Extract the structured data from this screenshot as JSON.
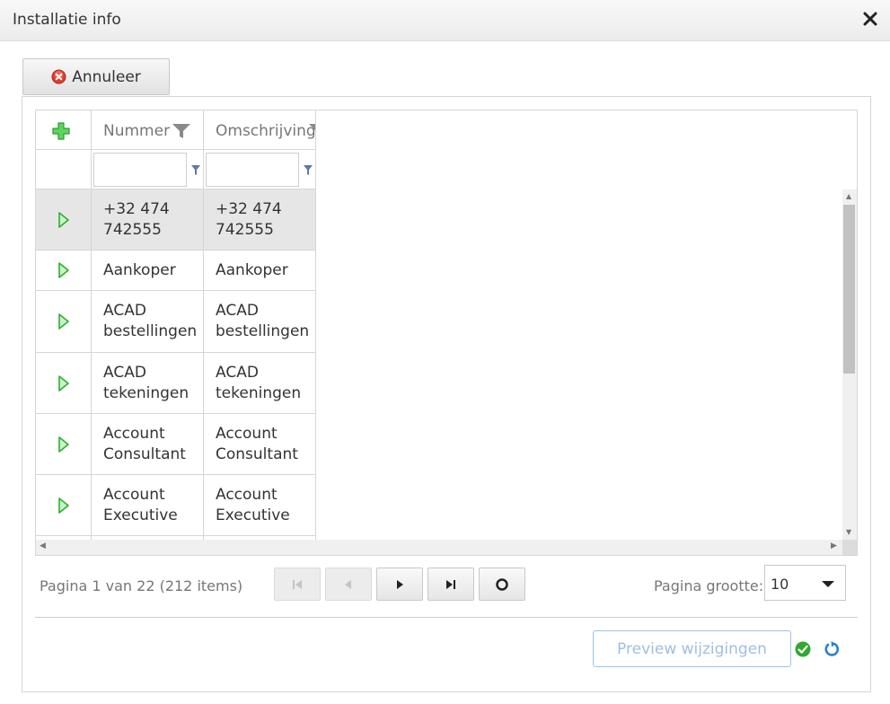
{
  "window": {
    "title": "Installatie info"
  },
  "toolbar": {
    "cancel_label": "Annuleer"
  },
  "grid": {
    "columns": [
      "Nummer",
      "Omschrijving"
    ],
    "rows": [
      {
        "nummer": [
          "+32 474",
          "742555"
        ],
        "omschrijving": [
          "+32 474",
          "742555"
        ],
        "selected": true
      },
      {
        "nummer": [
          "Aankoper"
        ],
        "omschrijving": [
          "Aankoper"
        ]
      },
      {
        "nummer": [
          "ACAD",
          "bestellingen"
        ],
        "omschrijving": [
          "ACAD",
          "bestellingen"
        ]
      },
      {
        "nummer": [
          "ACAD",
          "tekeningen"
        ],
        "omschrijving": [
          "ACAD",
          "tekeningen"
        ]
      },
      {
        "nummer": [
          "Account",
          "Consultant"
        ],
        "omschrijving": [
          "Account",
          "Consultant"
        ]
      },
      {
        "nummer": [
          "Account",
          "Executive"
        ],
        "omschrijving": [
          "Account",
          "Executive"
        ]
      }
    ]
  },
  "pager": {
    "info": "Pagina 1 van 22 (212 items)",
    "size_label": "Pagina grootte:",
    "size_value": "10"
  },
  "footer": {
    "preview_label": "Preview wijzigingen"
  },
  "colors": {
    "accent_green": "#3fb53f",
    "accent_blue": "#2a7fd4",
    "cancel_red": "#e03b2b"
  }
}
